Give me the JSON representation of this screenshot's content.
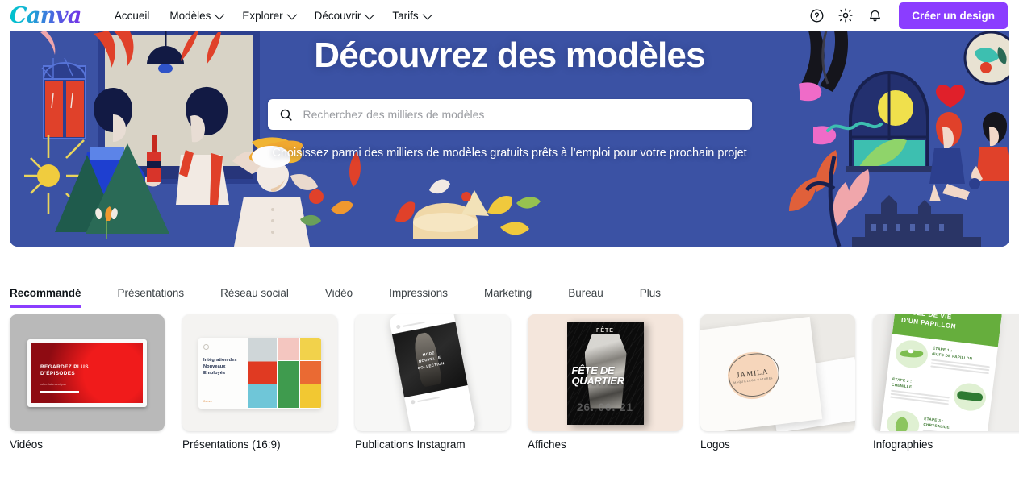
{
  "header": {
    "logo_text": "Canva",
    "nav": [
      {
        "label": "Accueil",
        "has_chevron": false
      },
      {
        "label": "Modèles",
        "has_chevron": true
      },
      {
        "label": "Explorer",
        "has_chevron": true
      },
      {
        "label": "Découvrir",
        "has_chevron": true
      },
      {
        "label": "Tarifs",
        "has_chevron": true
      }
    ],
    "icons": [
      {
        "name": "help-icon",
        "glyph": "?"
      },
      {
        "name": "gear-icon",
        "glyph": "gear"
      },
      {
        "name": "bell-icon",
        "glyph": "bell"
      }
    ],
    "cta_label": "Créer un design",
    "cta_color": "#8b3dff"
  },
  "hero": {
    "title": "Découvrez des modèles",
    "subtitle": "Choisissez parmi des milliers de modèles gratuits prêts à l’emploi pour votre prochain projet",
    "background_color": "#3b52a4",
    "search": {
      "value": "",
      "placeholder": "Recherchez des milliers de modèles",
      "icon": "search-icon"
    }
  },
  "tabs": {
    "active": "Recommandé",
    "underline_color": "#8b3dff",
    "items": [
      {
        "label": "Recommandé"
      },
      {
        "label": "Présentations"
      },
      {
        "label": "Réseau social"
      },
      {
        "label": "Vidéo"
      },
      {
        "label": "Impressions"
      },
      {
        "label": "Marketing"
      },
      {
        "label": "Bureau"
      },
      {
        "label": "Plus"
      }
    ]
  },
  "cards": [
    {
      "label": "Vidéos",
      "thumb": {
        "kind": "video-slide",
        "heading": "REGARDEZ PLUS\nD’ÉPISODES",
        "subheading": "rollerstaterdesigner",
        "frame_color": "#b9b9b9",
        "slide_color": "#f01b1b"
      }
    },
    {
      "label": "Présentations (16:9)",
      "thumb": {
        "kind": "presentation-slide",
        "heading": "Intégration des\nNouveaux\nEmployés",
        "tag": "Canva",
        "frame_color": "#f4f3f1"
      }
    },
    {
      "label": "Publications Instagram",
      "thumb": {
        "kind": "phone-mockup",
        "post_caption": "MODE\nNOUVELLE\nCOLLECTION",
        "frame_color": "#f7f7f6"
      }
    },
    {
      "label": "Affiches",
      "thumb": {
        "kind": "poster",
        "kicker": "FÊTE",
        "title": "FÊTE DE QUARTIER",
        "date": "26. 06. 21",
        "frame_color": "#f4e6dc"
      }
    },
    {
      "label": "Logos",
      "thumb": {
        "kind": "logo-mockup",
        "brand": "JAMILA",
        "tagline": "MAQUILLAGE NATUREL",
        "frame_color": "#eceae6",
        "badge_color": "#f6d6bb"
      }
    },
    {
      "label": "Infographies",
      "thumb": {
        "kind": "infographic",
        "title": "CYCLE DE VIE\nD’UN PAPILLON",
        "accent_color": "#66ae3d",
        "steps": [
          {
            "label": "ÉTAPE 1 :\nŒUFS DE PAPILLON"
          },
          {
            "label": "ÉTAPE 2 :\nCHENILLE"
          },
          {
            "label": "ÉTAPE 3 :\nCHRYSALIDE"
          }
        ]
      }
    }
  ]
}
